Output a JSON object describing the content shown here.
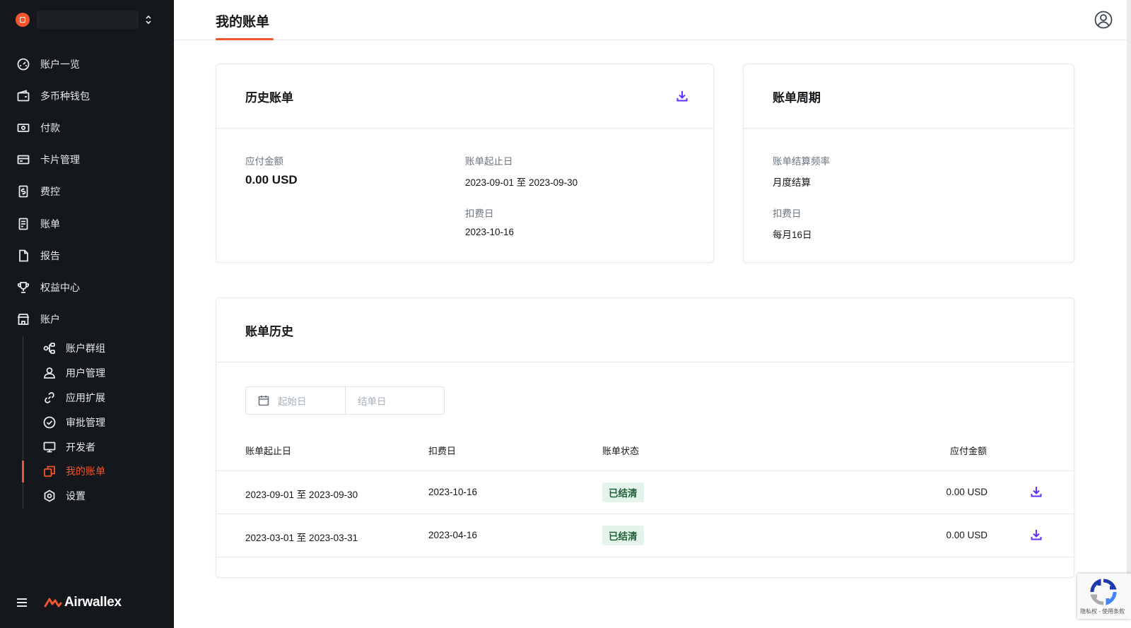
{
  "sidebar": {
    "brand": "Airwallex",
    "nav_items": [
      {
        "label": "账户一览",
        "icon": "dashboard-icon"
      },
      {
        "label": "多币种钱包",
        "icon": "wallet-icon"
      },
      {
        "label": "付款",
        "icon": "payment-icon"
      },
      {
        "label": "卡片管理",
        "icon": "card-icon"
      },
      {
        "label": "费控",
        "icon": "expense-icon"
      },
      {
        "label": "账单",
        "icon": "bill-icon"
      },
      {
        "label": "报告",
        "icon": "report-icon"
      },
      {
        "label": "权益中心",
        "icon": "trophy-icon"
      },
      {
        "label": "账户",
        "icon": "store-icon"
      }
    ],
    "sub_items": [
      {
        "label": "账户群组",
        "icon": "group-icon"
      },
      {
        "label": "用户管理",
        "icon": "user-icon"
      },
      {
        "label": "应用扩展",
        "icon": "link-icon"
      },
      {
        "label": "审批管理",
        "icon": "check-circle-icon"
      },
      {
        "label": "开发者",
        "icon": "monitor-icon"
      },
      {
        "label": "我的账单",
        "icon": "copy-icon",
        "active": true
      },
      {
        "label": "设置",
        "icon": "settings-icon"
      }
    ]
  },
  "header": {
    "title": "我的账单"
  },
  "history_bill": {
    "title": "历史账单",
    "amount_label": "应付金额",
    "amount_value": "0.00 USD",
    "period_label": "账单起止日",
    "period_value": "2023-09-01 至 2023-09-30",
    "debit_label": "扣费日",
    "debit_value": "2023-10-16"
  },
  "bill_cycle": {
    "title": "账单周期",
    "freq_label": "账单结算频率",
    "freq_value": "月度结算",
    "debit_label": "扣费日",
    "debit_value": "每月16日"
  },
  "bill_history": {
    "title": "账单历史",
    "start_placeholder": "起始日",
    "end_placeholder": "结单日",
    "columns": {
      "period": "账单起止日",
      "debit": "扣费日",
      "status": "账单状态",
      "amount": "应付金额"
    },
    "rows": [
      {
        "period": "2023-09-01 至 2023-09-30",
        "debit": "2023-10-16",
        "status": "已结清",
        "amount": "0.00 USD"
      },
      {
        "period": "2023-03-01 至 2023-03-31",
        "debit": "2023-04-16",
        "status": "已结清",
        "amount": "0.00 USD"
      }
    ]
  },
  "recaptcha": {
    "text": "隐私权 - 使用条款"
  },
  "colors": {
    "accent": "#f0562d",
    "sidebar_bg": "#14171b",
    "download_icon": "#612fff",
    "badge_bg": "#e4f4ea"
  }
}
